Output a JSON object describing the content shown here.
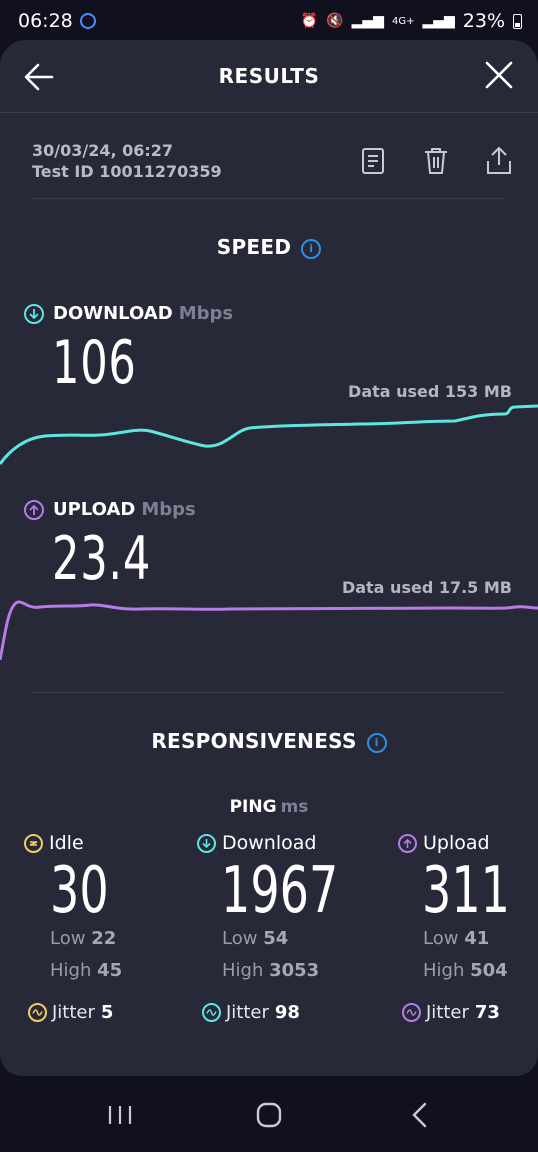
{
  "status": {
    "time": "06:28",
    "network": "4G+",
    "battery": "23%"
  },
  "header": {
    "title": "RESULTS"
  },
  "meta": {
    "date": "30/03/24, 06:27",
    "test_id": "Test ID 10011270359"
  },
  "speed": {
    "title": "SPEED",
    "download": {
      "label": "DOWNLOAD",
      "unit": "Mbps",
      "value": "106",
      "data_used": "Data used 153 MB"
    },
    "upload": {
      "label": "UPLOAD",
      "unit": "Mbps",
      "value": "23.4",
      "data_used": "Data used 17.5 MB"
    }
  },
  "responsiveness": {
    "title": "RESPONSIVENESS",
    "ping_label": "PING",
    "ping_unit": "ms",
    "columns": [
      {
        "label": "Idle",
        "value": "30",
        "low_label": "Low",
        "low": "22",
        "high_label": "High",
        "high": "45",
        "jitter_label": "Jitter",
        "jitter": "5"
      },
      {
        "label": "Download",
        "value": "1967",
        "low_label": "Low",
        "low": "54",
        "high_label": "High",
        "high": "3053",
        "jitter_label": "Jitter",
        "jitter": "98"
      },
      {
        "label": "Upload",
        "value": "311",
        "low_label": "Low",
        "low": "41",
        "high_label": "High",
        "high": "504",
        "jitter_label": "Jitter",
        "jitter": "73"
      }
    ]
  },
  "colors": {
    "download": "#5ee6e0",
    "upload": "#b77be8",
    "idle": "#f0d060",
    "info": "#2e8fe0"
  }
}
